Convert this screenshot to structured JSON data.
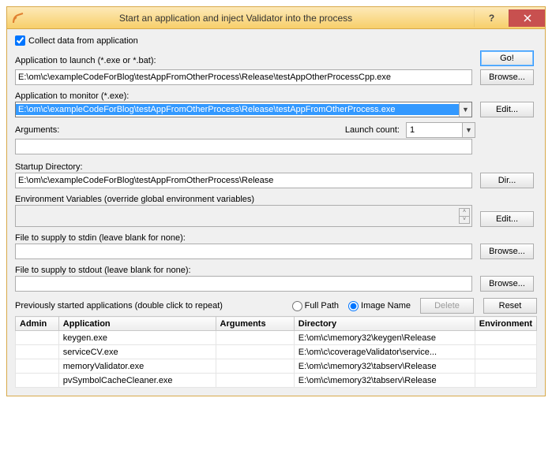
{
  "window": {
    "title": "Start an application and inject Validator into the process"
  },
  "checkbox": {
    "collect_label": "Collect data from application",
    "collect_checked": true
  },
  "fields": {
    "app_launch_label": "Application to launch (*.exe or *.bat):",
    "app_launch_value": "E:\\om\\c\\exampleCodeForBlog\\testAppFromOtherProcess\\Release\\testAppOtherProcessCpp.exe",
    "app_monitor_label": "Application to monitor (*.exe):",
    "app_monitor_value": "E:\\om\\c\\exampleCodeForBlog\\testAppFromOtherProcess\\Release\\testAppFromOtherProcess.exe",
    "arguments_label": "Arguments:",
    "arguments_value": "",
    "launch_count_label": "Launch count:",
    "launch_count_value": "1",
    "startup_dir_label": "Startup Directory:",
    "startup_dir_value": "E:\\om\\c\\exampleCodeForBlog\\testAppFromOtherProcess\\Release",
    "env_label": "Environment Variables (override global environment variables)",
    "stdin_label": "File to supply to stdin (leave blank for none):",
    "stdin_value": "",
    "stdout_label": "File to supply to stdout (leave blank for none):",
    "stdout_value": ""
  },
  "buttons": {
    "go": "Go!",
    "browse": "Browse...",
    "edit": "Edit...",
    "dir": "Dir...",
    "delete": "Delete",
    "reset": "Reset"
  },
  "prev": {
    "label": "Previously started applications (double click to repeat)",
    "radio_fullpath": "Full Path",
    "radio_imagename": "Image Name",
    "radio_selected": "imagename"
  },
  "table": {
    "headers": [
      "Admin",
      "Application",
      "Arguments",
      "Directory",
      "Environment"
    ],
    "rows": [
      {
        "admin": "",
        "app": "keygen.exe",
        "args": "",
        "dir": "E:\\om\\c\\memory32\\keygen\\Release",
        "env": ""
      },
      {
        "admin": "",
        "app": "serviceCV.exe",
        "args": "",
        "dir": "E:\\om\\c\\coverageValidator\\service...",
        "env": ""
      },
      {
        "admin": "",
        "app": "memoryValidator.exe",
        "args": "",
        "dir": "E:\\om\\c\\memory32\\tabserv\\Release",
        "env": ""
      },
      {
        "admin": "",
        "app": "pvSymbolCacheCleaner.exe",
        "args": "",
        "dir": "E:\\om\\c\\memory32\\tabserv\\Release",
        "env": ""
      }
    ]
  }
}
